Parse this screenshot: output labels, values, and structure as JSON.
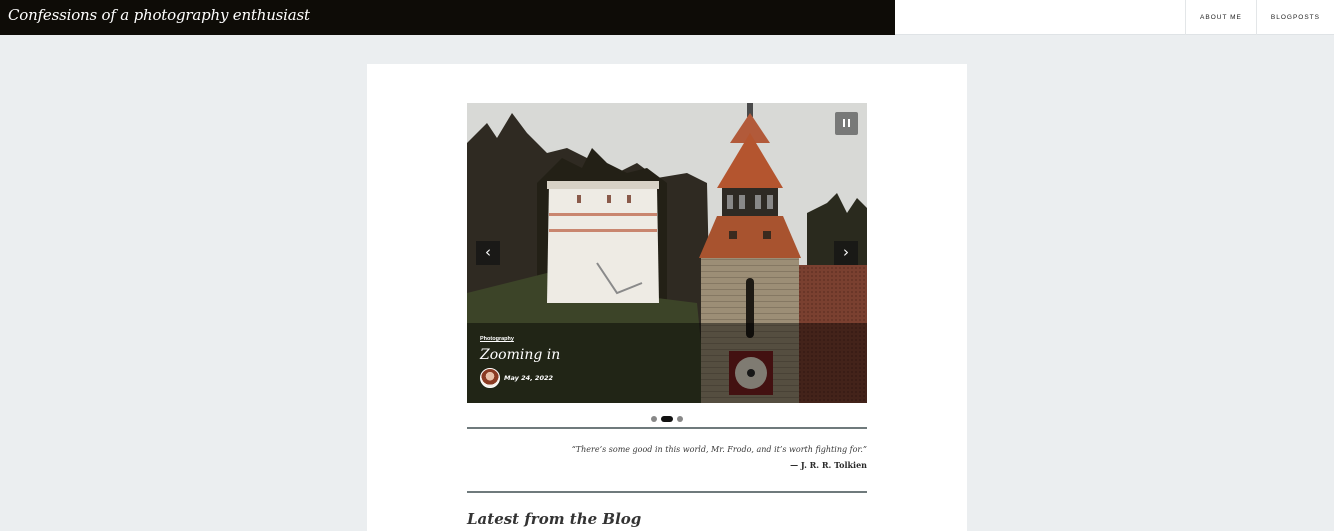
{
  "header": {
    "site_title": "Confessions of a photography enthusiast",
    "nav": [
      "ABOUT ME",
      "BLOGPOSTS"
    ]
  },
  "slider": {
    "category": "Photography",
    "title": "Zooming in",
    "date": "May 24, 2022",
    "slide_count": 3,
    "active_slide": 2,
    "icons": {
      "pause": "pause-icon",
      "prev": "chevron-left-icon",
      "next": "chevron-right-icon"
    },
    "arrow_prev": "‹",
    "arrow_next": "›"
  },
  "quote": {
    "text": "“There’s some good in this world, Mr. Frodo, and it’s worth fighting for.”",
    "author": "— J. R. R. Tolkien"
  },
  "section": {
    "title": "Latest from the Blog"
  },
  "colors": {
    "header_bg": "#0e0c07",
    "page_bg": "#ebeef0",
    "rule": "#6f7a7c"
  }
}
